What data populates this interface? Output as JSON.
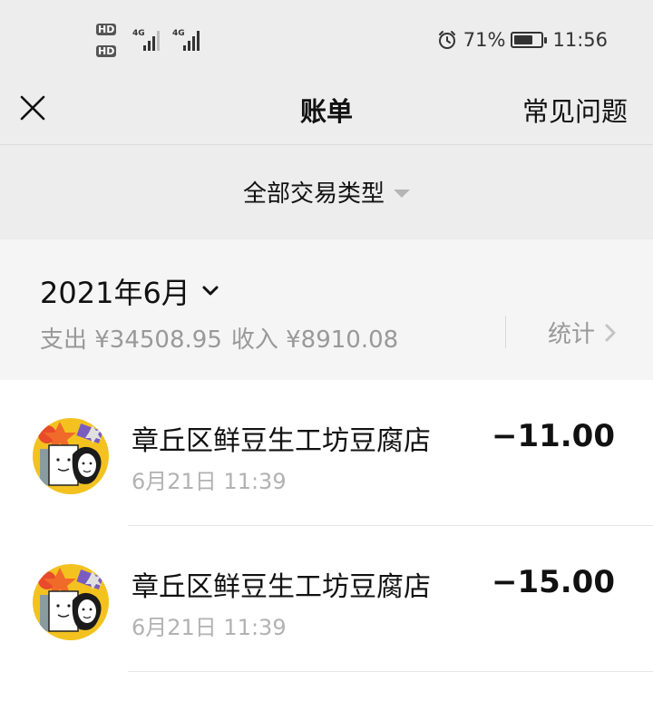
{
  "status_bar": {
    "hd1": "HD",
    "hd2": "HD",
    "net1": "4G",
    "net2": "4G",
    "battery_percent": "71%",
    "battery_level": 0.71,
    "time": "11:56",
    "icons": [
      "alarm-icon",
      "battery-icon",
      "signal-icon"
    ]
  },
  "navbar": {
    "title": "账单",
    "faq": "常见问题"
  },
  "filter": {
    "label": "全部交易类型"
  },
  "month": {
    "label": "2021年6月",
    "expense": "支出 ¥34508.95",
    "income": "收入 ¥8910.08",
    "stats": "统计"
  },
  "transactions": [
    {
      "merchant": "章丘区鲜豆生工坊豆腐店",
      "time": "6月21日 11:39",
      "amount": "−11.00"
    },
    {
      "merchant": "章丘区鲜豆生工坊豆腐店",
      "time": "6月21日 11:39",
      "amount": "−15.00"
    }
  ]
}
